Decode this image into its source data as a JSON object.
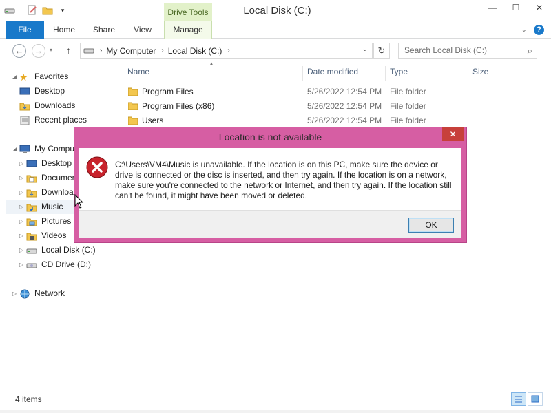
{
  "window": {
    "title": "Local Disk (C:)",
    "contextual_tab": "Drive Tools",
    "controls": [
      "minimize",
      "maximize",
      "close"
    ]
  },
  "ribbon": {
    "tabs": [
      "File",
      "Home",
      "Share",
      "View",
      "Manage"
    ],
    "help": "?"
  },
  "address": {
    "crumbs": [
      "My Computer",
      "Local Disk (C:)"
    ],
    "search_placeholder": "Search Local Disk (C:)"
  },
  "navpane": {
    "favorites": "Favorites",
    "fav_items": [
      "Desktop",
      "Downloads",
      "Recent places"
    ],
    "computer": "My Computer",
    "computer_items": [
      "Desktop",
      "Documents",
      "Downloads",
      "Music",
      "Pictures",
      "Videos",
      "Local Disk (C:)",
      "CD Drive (D:)"
    ],
    "network": "Network"
  },
  "columns": [
    "Name",
    "Date modified",
    "Type",
    "Size"
  ],
  "files": [
    {
      "name": "Program Files",
      "date": "5/26/2022 12:54 PM",
      "type": "File folder"
    },
    {
      "name": "Program Files (x86)",
      "date": "5/26/2022 12:54 PM",
      "type": "File folder"
    },
    {
      "name": "Users",
      "date": "5/26/2022 12:54 PM",
      "type": "File folder"
    }
  ],
  "status": {
    "count": "4 items"
  },
  "dialog": {
    "title": "Location is not available",
    "message": "C:\\Users\\VM4\\Music is unavailable. If the location is on this PC, make sure the device or drive is connected or the disc is inserted, and then try again. If the location is on a network, make sure you're connected to the network or Internet, and then try again. If the location still can't be found, it might have been moved or deleted.",
    "ok_label": "OK",
    "close": "✕"
  },
  "colors": {
    "accent": "#1979ca",
    "dialog_frame": "#d65ea3",
    "error_red": "#c7403b",
    "drive_tools": "#e2f1c9"
  }
}
